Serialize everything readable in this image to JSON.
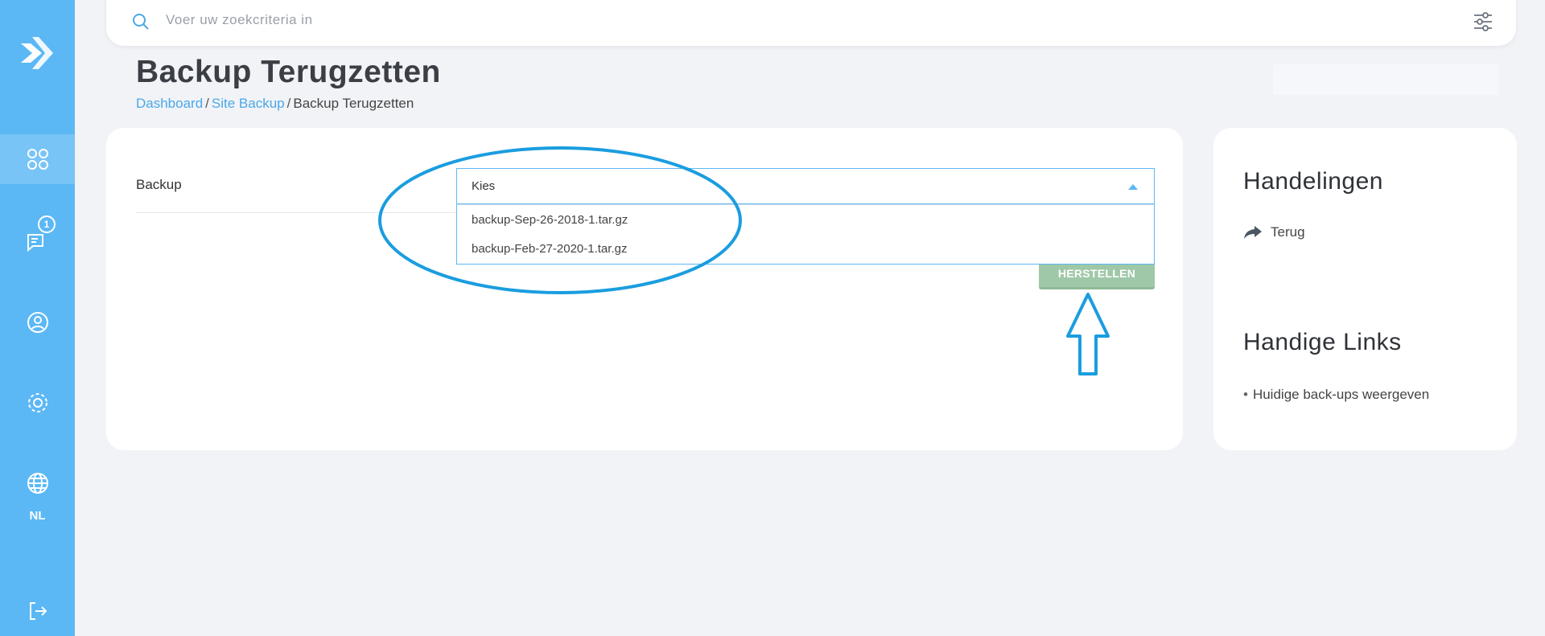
{
  "sidebar": {
    "lang": "NL",
    "notification_count": "1",
    "accent": "#5bb8f5"
  },
  "search": {
    "placeholder": "Voer uw zoekcriteria in"
  },
  "page": {
    "title": "Backup Terugzetten",
    "breadcrumb": [
      "Dashboard",
      "Site Backup",
      "Backup Terugzetten"
    ]
  },
  "form": {
    "label": "Backup",
    "select_value": "Kies",
    "options": [
      "backup-Sep-26-2018-1.tar.gz",
      "backup-Feb-27-2020-1.tar.gz"
    ],
    "restore_label": "HERSTELLEN"
  },
  "side": {
    "actions_title": "Handelingen",
    "back_label": "Terug",
    "links_title": "Handige Links",
    "links": [
      "Huidige back-ups weergeven"
    ]
  }
}
